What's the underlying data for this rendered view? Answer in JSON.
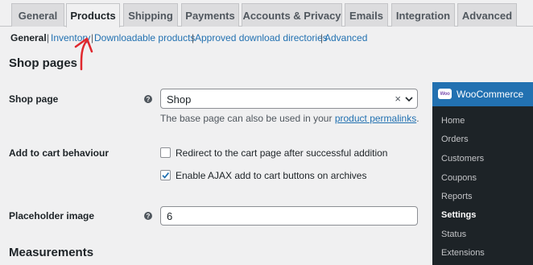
{
  "tabs": [
    {
      "label": "General"
    },
    {
      "label": "Products"
    },
    {
      "label": "Shipping"
    },
    {
      "label": "Payments"
    },
    {
      "label": "Accounts & Privacy"
    },
    {
      "label": "Emails"
    },
    {
      "label": "Integration"
    },
    {
      "label": "Advanced"
    }
  ],
  "subnav": {
    "general": "General",
    "inventory": "Inventory",
    "downloadable": "Downloadable products",
    "approved": "Approved download directories",
    "advanced": "Advanced",
    "separator": "|"
  },
  "section": {
    "shop_pages": "Shop pages",
    "measurements": "Measurements"
  },
  "shop_page": {
    "label": "Shop page",
    "help": "?",
    "value": "Shop",
    "clear": "×",
    "desc_prefix": "The base page can also be used in your ",
    "desc_link": "product permalinks",
    "desc_suffix": "."
  },
  "add_to_cart": {
    "label": "Add to cart behaviour",
    "redirect_label": "Redirect to the cart page after successful addition",
    "redirect_checked": false,
    "ajax_label": "Enable AJAX add to cart buttons on archives",
    "ajax_checked": true
  },
  "placeholder": {
    "label": "Placeholder image",
    "help": "?",
    "value": "6"
  },
  "wp_menu": {
    "logo": "Woo",
    "title": "WooCommerce",
    "items": [
      "Home",
      "Orders",
      "Customers",
      "Coupons",
      "Reports",
      "Settings",
      "Status",
      "Extensions"
    ],
    "current": "Settings"
  },
  "colors": {
    "accent": "#2271b1",
    "annotation_arrow": "#e0282e",
    "menu_bg": "#1d2327"
  }
}
